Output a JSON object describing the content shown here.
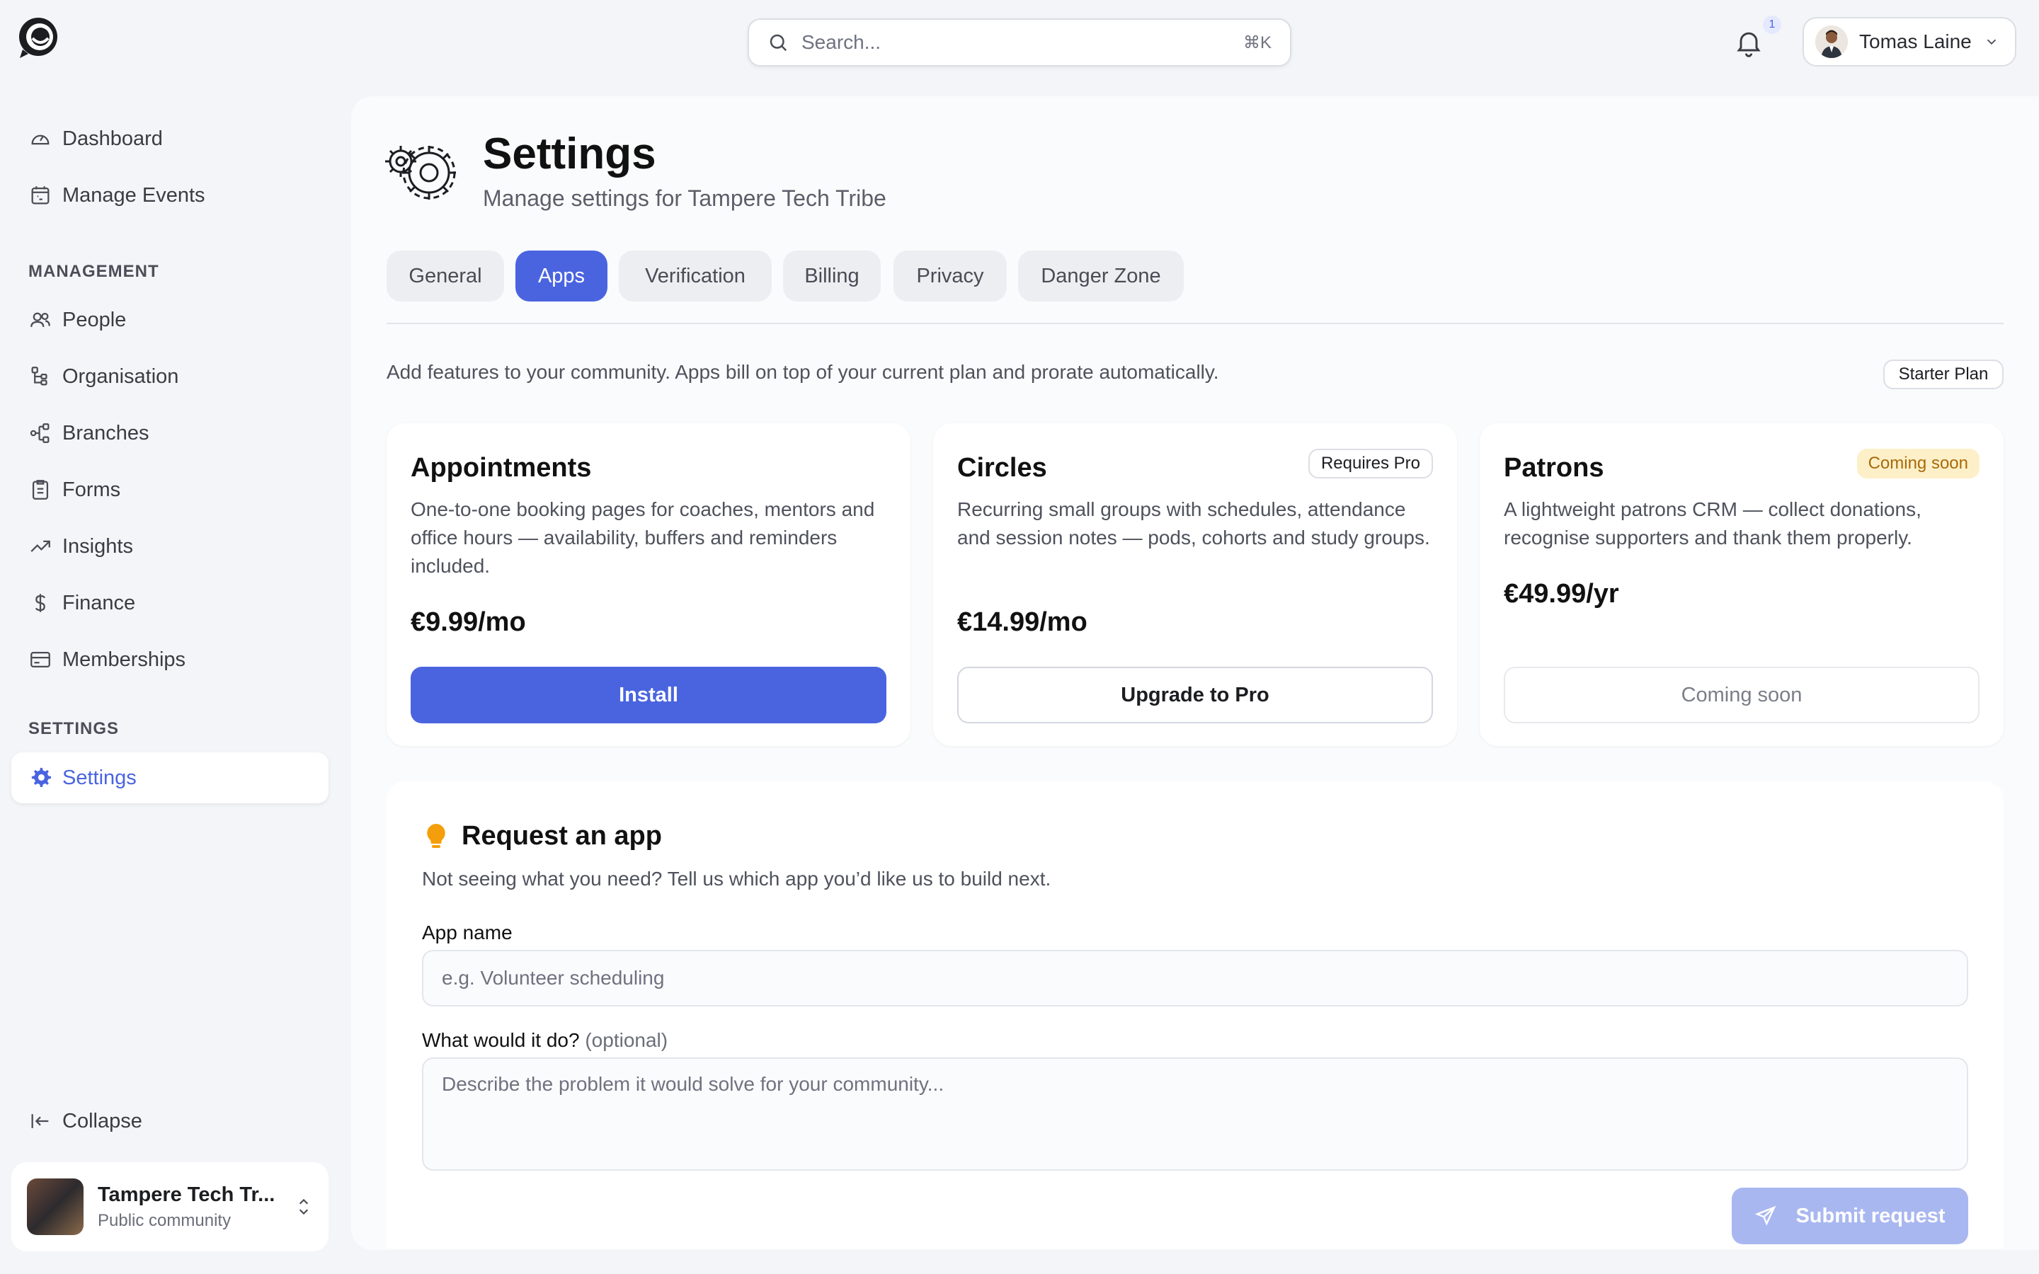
{
  "header": {
    "search_placeholder": "Search...",
    "search_shortcut": "⌘K",
    "notification_count": "1",
    "user_name": "Tomas Laine"
  },
  "sidebar": {
    "top_items": [
      {
        "label": "Dashboard",
        "icon": "gauge-icon"
      },
      {
        "label": "Manage Events",
        "icon": "calendar-icon"
      }
    ],
    "management_label": "MANAGEMENT",
    "management_items": [
      {
        "label": "People",
        "icon": "people-icon"
      },
      {
        "label": "Organisation",
        "icon": "org-tree-icon"
      },
      {
        "label": "Branches",
        "icon": "branches-icon"
      },
      {
        "label": "Forms",
        "icon": "form-icon"
      },
      {
        "label": "Insights",
        "icon": "trend-up-icon"
      },
      {
        "label": "Finance",
        "icon": "dollar-icon"
      },
      {
        "label": "Memberships",
        "icon": "card-icon"
      }
    ],
    "settings_label": "SETTINGS",
    "settings_item": {
      "label": "Settings",
      "icon": "gear-icon",
      "active": true
    },
    "collapse_label": "Collapse",
    "community": {
      "name": "Tampere Tech Tr...",
      "type": "Public community"
    }
  },
  "page": {
    "title": "Settings",
    "subtitle": "Manage settings for Tampere Tech Tribe",
    "tabs": [
      {
        "label": "General",
        "active": false
      },
      {
        "label": "Apps",
        "active": true
      },
      {
        "label": "Verification",
        "active": false
      },
      {
        "label": "Billing",
        "active": false
      },
      {
        "label": "Privacy",
        "active": false
      },
      {
        "label": "Danger Zone",
        "active": false
      }
    ],
    "intro": "Add features to your community. Apps bill on top of your current plan and prorate automatically.",
    "plan_badge": "Starter Plan"
  },
  "apps": [
    {
      "name": "Appointments",
      "badge": "",
      "description": "One-to-one booking pages for coaches, mentors and office hours — availability, buffers and reminders included.",
      "price": "€9.99/mo",
      "button": "Install"
    },
    {
      "name": "Circles",
      "badge": "Requires Pro",
      "description": "Recurring small groups with schedules, attendance and session notes — pods, cohorts and study groups.",
      "price": "€14.99/mo",
      "button": "Upgrade to Pro"
    },
    {
      "name": "Patrons",
      "badge": "Coming soon",
      "description": "A lightweight patrons CRM — collect donations, recognise supporters and thank them properly.",
      "price": "€49.99/yr",
      "button": "Coming soon"
    }
  ],
  "request": {
    "title": "Request an app",
    "subtitle": "Not seeing what you need? Tell us which app you’d like us to build next.",
    "app_name_label": "App name",
    "app_name_placeholder": "e.g. Volunteer scheduling",
    "desc_label": "What would it do?",
    "desc_optional": "(optional)",
    "desc_placeholder": "Describe the problem it would solve for your community...",
    "submit_label": "Submit request"
  },
  "colors": {
    "accent": "#4a64e0",
    "accent_disabled": "#a9b7f0",
    "warning_bg": "#fdf0c8",
    "warning_text": "#a86a0a"
  }
}
